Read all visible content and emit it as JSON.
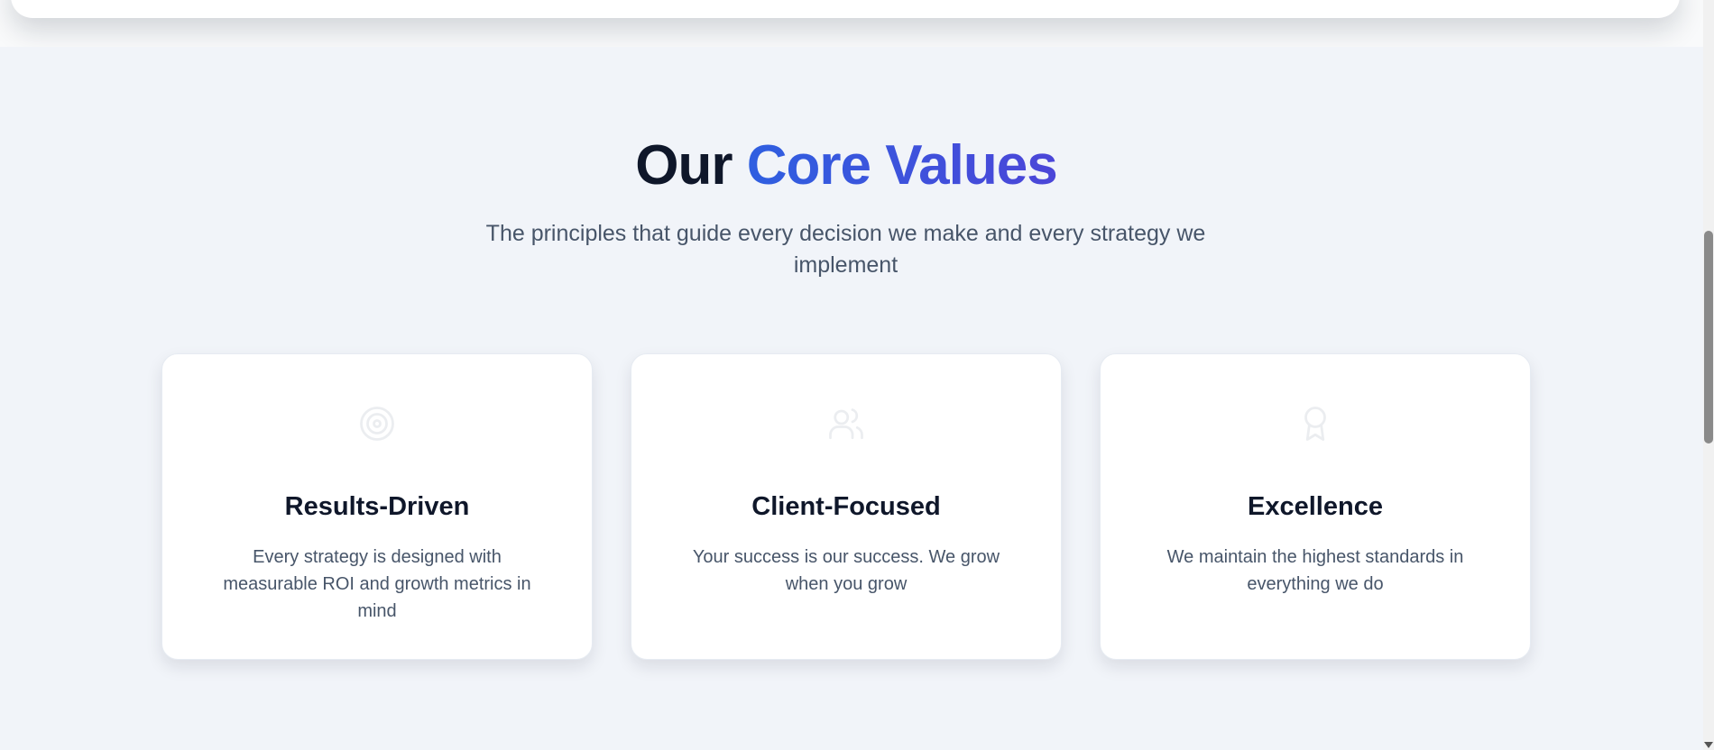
{
  "section": {
    "title_main": "Our ",
    "title_accent": "Core Values",
    "subtitle": "The principles that guide every decision we make and every strategy we implement"
  },
  "cards": [
    {
      "icon": "target-icon",
      "title": "Results-Driven",
      "description": "Every strategy is designed with measurable ROI and growth metrics in mind"
    },
    {
      "icon": "users-icon",
      "title": "Client-Focused",
      "description": "Your success is our success. We grow when you grow"
    },
    {
      "icon": "award-icon",
      "title": "Excellence",
      "description": "We maintain the highest standards in everything we do"
    }
  ],
  "colors": {
    "background": "#f1f4f9",
    "heading": "#0f172a",
    "accent": "#3b55e0",
    "body_text": "#475569",
    "card": "#ffffff"
  }
}
